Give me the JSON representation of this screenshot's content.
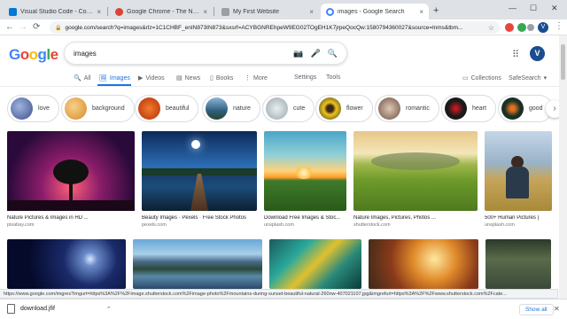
{
  "browser": {
    "tabs": [
      {
        "title": "Visual Studio Code - Code Editing",
        "favicon_color": "#0078d7"
      },
      {
        "title": "Google Chrome - The New Chrome",
        "favicon_color": "#db4437"
      },
      {
        "title": "My First Website",
        "favicon_color": "#9aa0a6"
      },
      {
        "title": "images - Google Search",
        "favicon_color": "#4285f4"
      }
    ],
    "new_tab": "+",
    "close": "×",
    "minimize": "—",
    "maximize": "☐",
    "window_close": "✕",
    "url": "google.com/search?q=images&rlz=1C1CHBF_enIN873IN873&sxsrf=ACYBGNREhpeW9EG02TOgEH1K7jrpeQocQw:1580794360027&source=lnms&tbm...",
    "profile_initial": "V"
  },
  "google": {
    "logo": "Google",
    "query": "images",
    "avatar_initial": "V",
    "tabs": [
      "All",
      "Images",
      "Videos",
      "News",
      "Books",
      "More"
    ],
    "tools": [
      "Settings",
      "Tools"
    ],
    "collections": "Collections",
    "safesearch": "SafeSearch"
  },
  "chips": [
    {
      "label": "love",
      "color": "#5a76b8"
    },
    {
      "label": "background",
      "color": "#e8a54a"
    },
    {
      "label": "beautiful",
      "color": "#d94e1f"
    },
    {
      "label": "nature",
      "color": "#3d6b8a"
    },
    {
      "label": "cute",
      "color": "#b8c3c8"
    },
    {
      "label": "flower",
      "color": "#e0b81a"
    },
    {
      "label": "romantic",
      "color": "#a88b7a"
    },
    {
      "label": "heart",
      "color": "#1a1a1a"
    },
    {
      "label": "good",
      "color": "#2b4a3a"
    }
  ],
  "results_row1": [
    {
      "title": "Nature Pictures & Images in HD ...",
      "source": "pixabay.com"
    },
    {
      "title": "Beauty Images · Pexels · Free Stock Photos",
      "source": "pexels.com"
    },
    {
      "title": "Download Free Images & Stoc...",
      "source": "unsplash.com"
    },
    {
      "title": "Nature Images, Pictures, Photos ...",
      "source": "shutterstock.com"
    },
    {
      "title": "500+ Human Pictures |",
      "source": "unsplash.com"
    }
  ],
  "status_url": "https://www.google.com/imgres?imgurl=https%3A%2F%2Fimage.shutterstock.com%2Fimage-photo%2Fmountains-during-sunset-beautiful-natural-260nw-407021107.jpg&imgrefurl=https%3A%2F%2Fwww.shutterstock.com%2Fcate...",
  "download": {
    "filename": "download.jfif",
    "show_all": "Show all"
  }
}
